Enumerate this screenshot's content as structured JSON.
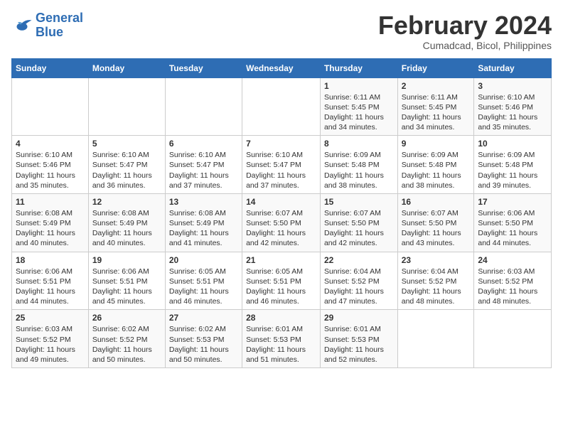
{
  "logo": {
    "line1": "General",
    "line2": "Blue"
  },
  "title": "February 2024",
  "subtitle": "Cumadcad, Bicol, Philippines",
  "headers": [
    "Sunday",
    "Monday",
    "Tuesday",
    "Wednesday",
    "Thursday",
    "Friday",
    "Saturday"
  ],
  "weeks": [
    [
      {
        "day": "",
        "info": ""
      },
      {
        "day": "",
        "info": ""
      },
      {
        "day": "",
        "info": ""
      },
      {
        "day": "",
        "info": ""
      },
      {
        "day": "1",
        "info": "Sunrise: 6:11 AM\nSunset: 5:45 PM\nDaylight: 11 hours\nand 34 minutes."
      },
      {
        "day": "2",
        "info": "Sunrise: 6:11 AM\nSunset: 5:45 PM\nDaylight: 11 hours\nand 34 minutes."
      },
      {
        "day": "3",
        "info": "Sunrise: 6:10 AM\nSunset: 5:46 PM\nDaylight: 11 hours\nand 35 minutes."
      }
    ],
    [
      {
        "day": "4",
        "info": "Sunrise: 6:10 AM\nSunset: 5:46 PM\nDaylight: 11 hours\nand 35 minutes."
      },
      {
        "day": "5",
        "info": "Sunrise: 6:10 AM\nSunset: 5:47 PM\nDaylight: 11 hours\nand 36 minutes."
      },
      {
        "day": "6",
        "info": "Sunrise: 6:10 AM\nSunset: 5:47 PM\nDaylight: 11 hours\nand 37 minutes."
      },
      {
        "day": "7",
        "info": "Sunrise: 6:10 AM\nSunset: 5:47 PM\nDaylight: 11 hours\nand 37 minutes."
      },
      {
        "day": "8",
        "info": "Sunrise: 6:09 AM\nSunset: 5:48 PM\nDaylight: 11 hours\nand 38 minutes."
      },
      {
        "day": "9",
        "info": "Sunrise: 6:09 AM\nSunset: 5:48 PM\nDaylight: 11 hours\nand 38 minutes."
      },
      {
        "day": "10",
        "info": "Sunrise: 6:09 AM\nSunset: 5:48 PM\nDaylight: 11 hours\nand 39 minutes."
      }
    ],
    [
      {
        "day": "11",
        "info": "Sunrise: 6:08 AM\nSunset: 5:49 PM\nDaylight: 11 hours\nand 40 minutes."
      },
      {
        "day": "12",
        "info": "Sunrise: 6:08 AM\nSunset: 5:49 PM\nDaylight: 11 hours\nand 40 minutes."
      },
      {
        "day": "13",
        "info": "Sunrise: 6:08 AM\nSunset: 5:49 PM\nDaylight: 11 hours\nand 41 minutes."
      },
      {
        "day": "14",
        "info": "Sunrise: 6:07 AM\nSunset: 5:50 PM\nDaylight: 11 hours\nand 42 minutes."
      },
      {
        "day": "15",
        "info": "Sunrise: 6:07 AM\nSunset: 5:50 PM\nDaylight: 11 hours\nand 42 minutes."
      },
      {
        "day": "16",
        "info": "Sunrise: 6:07 AM\nSunset: 5:50 PM\nDaylight: 11 hours\nand 43 minutes."
      },
      {
        "day": "17",
        "info": "Sunrise: 6:06 AM\nSunset: 5:50 PM\nDaylight: 11 hours\nand 44 minutes."
      }
    ],
    [
      {
        "day": "18",
        "info": "Sunrise: 6:06 AM\nSunset: 5:51 PM\nDaylight: 11 hours\nand 44 minutes."
      },
      {
        "day": "19",
        "info": "Sunrise: 6:06 AM\nSunset: 5:51 PM\nDaylight: 11 hours\nand 45 minutes."
      },
      {
        "day": "20",
        "info": "Sunrise: 6:05 AM\nSunset: 5:51 PM\nDaylight: 11 hours\nand 46 minutes."
      },
      {
        "day": "21",
        "info": "Sunrise: 6:05 AM\nSunset: 5:51 PM\nDaylight: 11 hours\nand 46 minutes."
      },
      {
        "day": "22",
        "info": "Sunrise: 6:04 AM\nSunset: 5:52 PM\nDaylight: 11 hours\nand 47 minutes."
      },
      {
        "day": "23",
        "info": "Sunrise: 6:04 AM\nSunset: 5:52 PM\nDaylight: 11 hours\nand 48 minutes."
      },
      {
        "day": "24",
        "info": "Sunrise: 6:03 AM\nSunset: 5:52 PM\nDaylight: 11 hours\nand 48 minutes."
      }
    ],
    [
      {
        "day": "25",
        "info": "Sunrise: 6:03 AM\nSunset: 5:52 PM\nDaylight: 11 hours\nand 49 minutes."
      },
      {
        "day": "26",
        "info": "Sunrise: 6:02 AM\nSunset: 5:52 PM\nDaylight: 11 hours\nand 50 minutes."
      },
      {
        "day": "27",
        "info": "Sunrise: 6:02 AM\nSunset: 5:53 PM\nDaylight: 11 hours\nand 50 minutes."
      },
      {
        "day": "28",
        "info": "Sunrise: 6:01 AM\nSunset: 5:53 PM\nDaylight: 11 hours\nand 51 minutes."
      },
      {
        "day": "29",
        "info": "Sunrise: 6:01 AM\nSunset: 5:53 PM\nDaylight: 11 hours\nand 52 minutes."
      },
      {
        "day": "",
        "info": ""
      },
      {
        "day": "",
        "info": ""
      }
    ]
  ]
}
